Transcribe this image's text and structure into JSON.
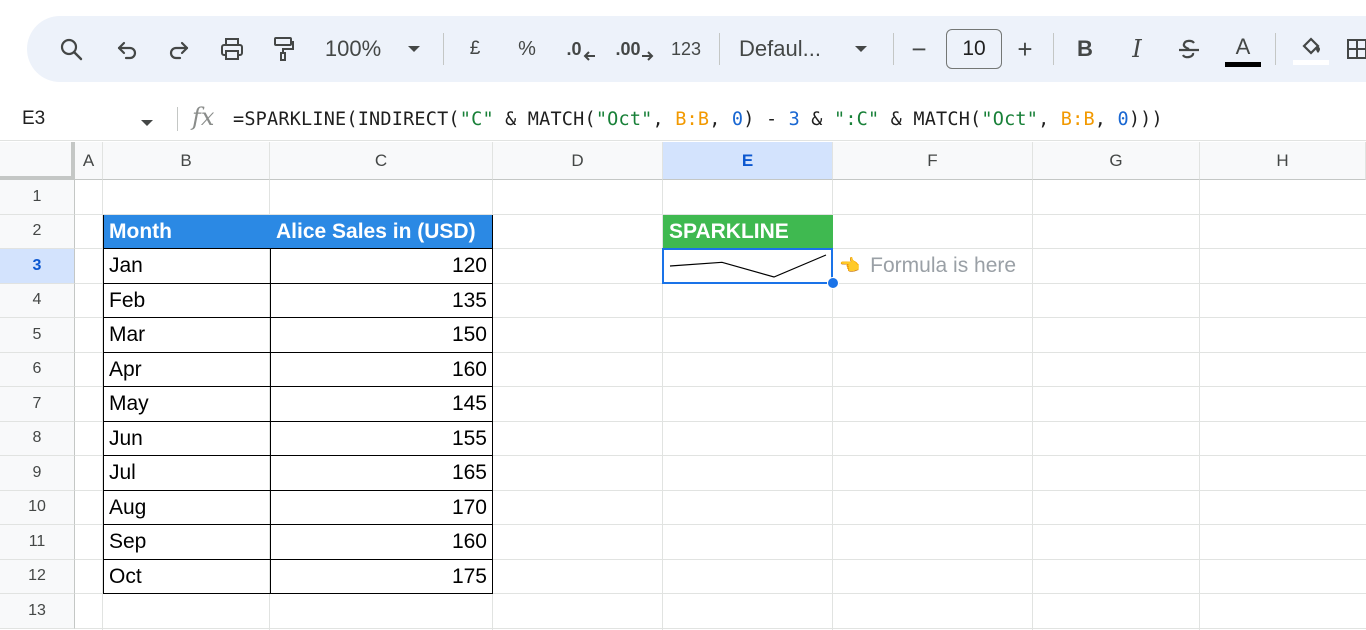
{
  "toolbar": {
    "zoom": "100%",
    "currency": "£",
    "percent": "%",
    "decrease_decimal": ".0",
    "increase_decimal": ".00",
    "number_format": "123",
    "font_name": "Defaul...",
    "font_size": "10",
    "minus": "−",
    "plus": "+",
    "bold": "B",
    "italic": "I",
    "text_color": "A"
  },
  "formula_bar": {
    "name_box": "E3",
    "fx": "fx",
    "tokens": [
      {
        "t": "=SPARKLINE(INDIRECT(",
        "k": "plain"
      },
      {
        "t": "\"C\"",
        "k": "str"
      },
      {
        "t": " & MATCH(",
        "k": "plain"
      },
      {
        "t": "\"Oct\"",
        "k": "str"
      },
      {
        "t": ", ",
        "k": "plain"
      },
      {
        "t": "B:B",
        "k": "ref"
      },
      {
        "t": ", ",
        "k": "plain"
      },
      {
        "t": "0",
        "k": "num"
      },
      {
        "t": ") - ",
        "k": "plain"
      },
      {
        "t": "3",
        "k": "num"
      },
      {
        "t": " & ",
        "k": "plain"
      },
      {
        "t": "\":C\"",
        "k": "str"
      },
      {
        "t": " & MATCH(",
        "k": "plain"
      },
      {
        "t": "\"Oct\"",
        "k": "str"
      },
      {
        "t": ", ",
        "k": "plain"
      },
      {
        "t": "B:B",
        "k": "ref"
      },
      {
        "t": ", ",
        "k": "plain"
      },
      {
        "t": "0",
        "k": "num"
      },
      {
        "t": ")))",
        "k": "plain"
      }
    ]
  },
  "columns": [
    "A",
    "B",
    "C",
    "D",
    "E",
    "F",
    "G",
    "H"
  ],
  "selected_column": "E",
  "rows": [
    "1",
    "2",
    "3",
    "4",
    "5",
    "6",
    "7",
    "8",
    "9",
    "10",
    "11",
    "12",
    "13"
  ],
  "selected_row": "3",
  "table": {
    "headers": [
      "Month",
      "Alice Sales in (USD)"
    ],
    "rows": [
      [
        "Jan",
        "120"
      ],
      [
        "Feb",
        "135"
      ],
      [
        "Mar",
        "150"
      ],
      [
        "Apr",
        "160"
      ],
      [
        "May",
        "145"
      ],
      [
        "Jun",
        "155"
      ],
      [
        "Jul",
        "165"
      ],
      [
        "Aug",
        "170"
      ],
      [
        "Sep",
        "160"
      ],
      [
        "Oct",
        "175"
      ]
    ]
  },
  "sparkline": {
    "header": "SPARKLINE",
    "values": [
      160,
      165,
      145,
      175
    ]
  },
  "annotation": "Formula is here",
  "colors": {
    "table_header": "#2b89e4",
    "sparkline_header": "#3fb950",
    "selection": "#1a73e8"
  },
  "icons": [
    "search-icon",
    "undo-icon",
    "redo-icon",
    "print-icon",
    "paint-format-icon",
    "chevron-down-icon",
    "bold-icon",
    "italic-icon",
    "strikethrough-icon",
    "text-color-icon",
    "fill-color-icon",
    "hand-pointing-left-icon"
  ]
}
